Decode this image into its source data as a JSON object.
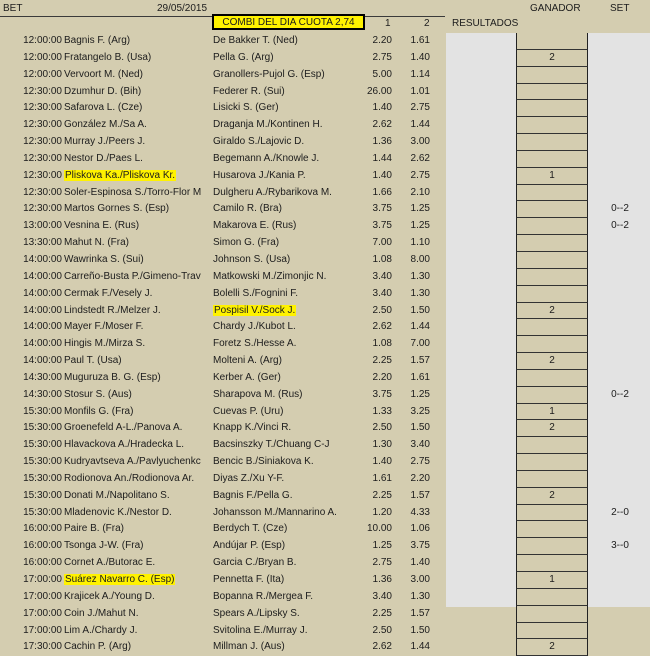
{
  "header": {
    "bet": "BET",
    "date": "29/05/2015",
    "combi": "COMBI DEL DIA CUOTA 2,74",
    "col1": "1",
    "col2": "2",
    "resultados": "RESULTADOS",
    "ganador": "GANADOR",
    "set": "SET"
  },
  "colors": {
    "highlight": "#fff200",
    "background": "#d4cdb0",
    "results_col": "#e3e3e3"
  },
  "rows": [
    {
      "time": "12:00:00",
      "p1": "Bagnis F. (Arg)",
      "p2": "De Bakker T. (Ned)",
      "o1": "2.20",
      "o2": "1.61",
      "ganador": "",
      "set": ""
    },
    {
      "time": "12:00:00",
      "p1": "Fratangelo B. (Usa)",
      "p2": "Pella G. (Arg)",
      "o1": "2.75",
      "o2": "1.40",
      "ganador": "2",
      "set": ""
    },
    {
      "time": "12:00:00",
      "p1": "Vervoort M. (Ned)",
      "p2": "Granollers-Pujol G. (Esp)",
      "o1": "5.00",
      "o2": "1.14",
      "ganador": "",
      "set": ""
    },
    {
      "time": "12:30:00",
      "p1": "Dzumhur D. (Bih)",
      "p2": "Federer R. (Sui)",
      "o1": "26.00",
      "o2": "1.01",
      "ganador": "",
      "set": ""
    },
    {
      "time": "12:30:00",
      "p1": "Safarova L. (Cze)",
      "p2": "Lisicki S. (Ger)",
      "o1": "1.40",
      "o2": "2.75",
      "ganador": "",
      "set": ""
    },
    {
      "time": "12:30:00",
      "p1": "González M./Sa A.",
      "p2": "Draganja M./Kontinen H.",
      "o1": "2.62",
      "o2": "1.44",
      "ganador": "",
      "set": ""
    },
    {
      "time": "12:30:00",
      "p1": "Murray J./Peers J.",
      "p2": "Giraldo S./Lajovic D.",
      "o1": "1.36",
      "o2": "3.00",
      "ganador": "",
      "set": ""
    },
    {
      "time": "12:30:00",
      "p1": "Nestor D./Paes L.",
      "p2": "Begemann A./Knowle J.",
      "o1": "1.44",
      "o2": "2.62",
      "ganador": "",
      "set": ""
    },
    {
      "time": "12:30:00",
      "p1": "Pliskova Ka./Pliskova Kr.",
      "p2": "Husarova J./Kania P.",
      "o1": "1.40",
      "o2": "2.75",
      "ganador": "1",
      "set": "",
      "hl1": true
    },
    {
      "time": "12:30:00",
      "p1": "Soler-Espinosa S./Torro-Flor M",
      "p2": "Dulgheru A./Rybarikova M.",
      "o1": "1.66",
      "o2": "2.10",
      "ganador": "",
      "set": ""
    },
    {
      "time": "12:30:00",
      "p1": "Martos Gornes S. (Esp)",
      "p2": "Camilo R. (Bra)",
      "o1": "3.75",
      "o2": "1.25",
      "ganador": "",
      "set": "0--2"
    },
    {
      "time": "13:00:00",
      "p1": "Vesnina E. (Rus)",
      "p2": "Makarova E. (Rus)",
      "o1": "3.75",
      "o2": "1.25",
      "ganador": "",
      "set": "0--2"
    },
    {
      "time": "13:30:00",
      "p1": "Mahut N. (Fra)",
      "p2": "Simon G. (Fra)",
      "o1": "7.00",
      "o2": "1.10",
      "ganador": "",
      "set": ""
    },
    {
      "time": "14:00:00",
      "p1": "Wawrinka S. (Sui)",
      "p2": "Johnson S. (Usa)",
      "o1": "1.08",
      "o2": "8.00",
      "ganador": "",
      "set": ""
    },
    {
      "time": "14:00:00",
      "p1": "Carreño-Busta P./Gimeno-Trav",
      "p2": "Matkowski M./Zimonjic N.",
      "o1": "3.40",
      "o2": "1.30",
      "ganador": "",
      "set": ""
    },
    {
      "time": "14:00:00",
      "p1": "Cermak F./Vesely J.",
      "p2": "Bolelli S./Fognini F.",
      "o1": "3.40",
      "o2": "1.30",
      "ganador": "",
      "set": ""
    },
    {
      "time": "14:00:00",
      "p1": "Lindstedt R./Melzer J.",
      "p2": "Pospisil V./Sock J.",
      "o1": "2.50",
      "o2": "1.50",
      "ganador": "2",
      "set": "",
      "hl2": true
    },
    {
      "time": "14:00:00",
      "p1": "Mayer F./Moser F.",
      "p2": "Chardy J./Kubot L.",
      "o1": "2.62",
      "o2": "1.44",
      "ganador": "",
      "set": ""
    },
    {
      "time": "14:00:00",
      "p1": "Hingis M./Mirza S.",
      "p2": "Foretz S./Hesse A.",
      "o1": "1.08",
      "o2": "7.00",
      "ganador": "",
      "set": ""
    },
    {
      "time": "14:00:00",
      "p1": "Paul T. (Usa)",
      "p2": "Molteni A. (Arg)",
      "o1": "2.25",
      "o2": "1.57",
      "ganador": "2",
      "set": ""
    },
    {
      "time": "14:30:00",
      "p1": "Muguruza B. G. (Esp)",
      "p2": "Kerber A. (Ger)",
      "o1": "2.20",
      "o2": "1.61",
      "ganador": "",
      "set": ""
    },
    {
      "time": "14:30:00",
      "p1": "Stosur S. (Aus)",
      "p2": "Sharapova M. (Rus)",
      "o1": "3.75",
      "o2": "1.25",
      "ganador": "",
      "set": "0--2"
    },
    {
      "time": "15:30:00",
      "p1": "Monfils G. (Fra)",
      "p2": "Cuevas P. (Uru)",
      "o1": "1.33",
      "o2": "3.25",
      "ganador": "1",
      "set": ""
    },
    {
      "time": "15:30:00",
      "p1": "Groenefeld A-L./Panova A.",
      "p2": "Knapp K./Vinci R.",
      "o1": "2.50",
      "o2": "1.50",
      "ganador": "2",
      "set": ""
    },
    {
      "time": "15:30:00",
      "p1": "Hlavackova A./Hradecka L.",
      "p2": "Bacsinszky T./Chuang C-J",
      "o1": "1.30",
      "o2": "3.40",
      "ganador": "",
      "set": ""
    },
    {
      "time": "15:30:00",
      "p1": "Kudryavtseva A./Pavlyuchenkc",
      "p2": "Bencic B./Siniakova K.",
      "o1": "1.40",
      "o2": "2.75",
      "ganador": "",
      "set": ""
    },
    {
      "time": "15:30:00",
      "p1": "Rodionova An./Rodionova Ar.",
      "p2": "Diyas Z./Xu Y-F.",
      "o1": "1.61",
      "o2": "2.20",
      "ganador": "",
      "set": ""
    },
    {
      "time": "15:30:00",
      "p1": "Donati M./Napolitano S.",
      "p2": "Bagnis F./Pella G.",
      "o1": "2.25",
      "o2": "1.57",
      "ganador": "2",
      "set": ""
    },
    {
      "time": "15:30:00",
      "p1": "Mladenovic K./Nestor D.",
      "p2": "Johansson M./Mannarino A.",
      "o1": "1.20",
      "o2": "4.33",
      "ganador": "",
      "set": "2--0"
    },
    {
      "time": "16:00:00",
      "p1": "Paire B. (Fra)",
      "p2": "Berdych T. (Cze)",
      "o1": "10.00",
      "o2": "1.06",
      "ganador": "",
      "set": ""
    },
    {
      "time": "16:00:00",
      "p1": "Tsonga J-W. (Fra)",
      "p2": "Andújar P. (Esp)",
      "o1": "1.25",
      "o2": "3.75",
      "ganador": "",
      "set": "3--0"
    },
    {
      "time": "16:00:00",
      "p1": "Cornet A./Butorac E.",
      "p2": "Garcia C./Bryan B.",
      "o1": "2.75",
      "o2": "1.40",
      "ganador": "",
      "set": ""
    },
    {
      "time": "17:00:00",
      "p1": "Suárez Navarro C. (Esp)",
      "p2": "Pennetta F. (Ita)",
      "o1": "1.36",
      "o2": "3.00",
      "ganador": "1",
      "set": "",
      "hl1": true
    },
    {
      "time": "17:00:00",
      "p1": "Krajicek A./Young D.",
      "p2": "Bopanna R./Mergea F.",
      "o1": "3.40",
      "o2": "1.30",
      "ganador": "",
      "set": ""
    },
    {
      "time": "17:00:00",
      "p1": "Coin J./Mahut N.",
      "p2": "Spears A./Lipsky S.",
      "o1": "2.25",
      "o2": "1.57",
      "ganador": "",
      "set": ""
    },
    {
      "time": "17:00:00",
      "p1": "Lim A./Chardy J.",
      "p2": "Svitolina E./Murray J.",
      "o1": "2.50",
      "o2": "1.50",
      "ganador": "",
      "set": ""
    },
    {
      "time": "17:30:00",
      "p1": "Cachin P. (Arg)",
      "p2": "Millman J. (Aus)",
      "o1": "2.62",
      "o2": "1.44",
      "ganador": "2",
      "set": ""
    }
  ]
}
